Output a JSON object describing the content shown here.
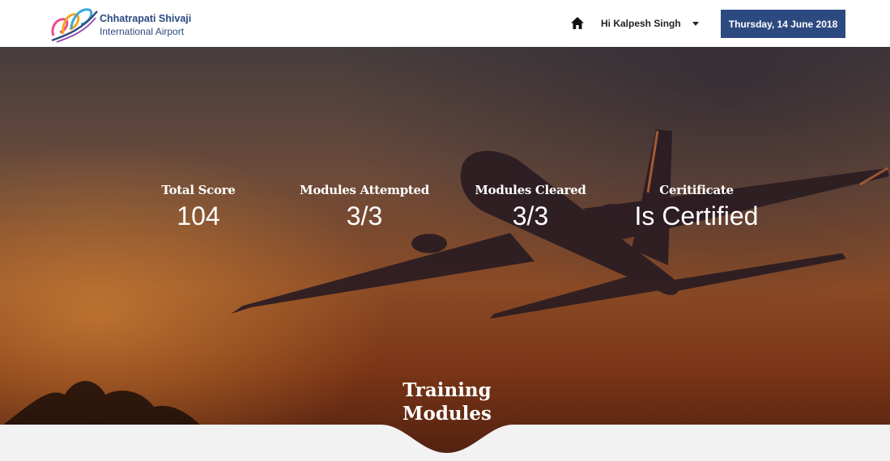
{
  "brand": {
    "line1": "Chhatrapati Shivaji",
    "line2": "International Airport",
    "logo_icon": "csia-swirl-logo",
    "colors": {
      "primary": "#2d4a80"
    }
  },
  "header": {
    "home_icon": "home-icon",
    "greeting": "Hi Kalpesh Singh",
    "user_menu_icon": "caret-down-icon",
    "date": "Thursday, 14 June 2018"
  },
  "stats": [
    {
      "label": "Total Score",
      "value": "104"
    },
    {
      "label": "Modules Attempted",
      "value": "3/3"
    },
    {
      "label": "Modules Cleared",
      "value": "3/3"
    },
    {
      "label": "Ceritificate",
      "value": "Is Certified"
    }
  ],
  "section": {
    "title_line1": "Training",
    "title_line2": "Modules"
  }
}
